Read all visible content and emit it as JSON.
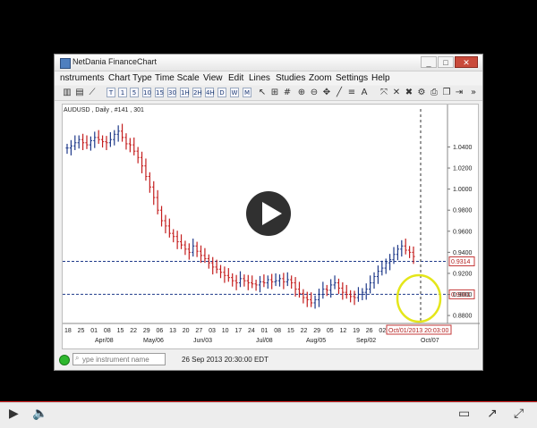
{
  "window": {
    "title": "NetDania FinanceChart",
    "min": "_",
    "max": "□",
    "close": "✕"
  },
  "menu": [
    "nstruments",
    "Chart Type",
    "Time Scale",
    "View",
    "Edit",
    "Lines",
    "Studies",
    "Zoom",
    "Settings",
    "Help"
  ],
  "toolbar": {
    "timescales": [
      "T",
      "1",
      "5",
      "10",
      "15",
      "30",
      "1H",
      "2H",
      "4H",
      "D",
      "W",
      "M"
    ],
    "icons": [
      "cursor-icon",
      "grid-icon",
      "hash-icon",
      "crosshair-icon",
      "close-x-icon",
      "print-icon",
      "scroll-icon",
      "more-icon"
    ]
  },
  "chart_data": {
    "type": "line",
    "title": "AUDUSD , Daily , #141 , 301",
    "ylim": [
      0.875,
      1.065
    ],
    "yticks": [
      "1.0400",
      "1.0200",
      "1.0000",
      "0.9800",
      "0.9600",
      "0.9400",
      "0.9200",
      "0.9000",
      "0.8800"
    ],
    "x_day_labels": [
      "18",
      "25",
      "01",
      "08",
      "15",
      "22",
      "29",
      "06",
      "13",
      "20",
      "27",
      "03",
      "10",
      "17",
      "24",
      "01",
      "08",
      "15",
      "22",
      "29",
      "05",
      "12",
      "19",
      "26",
      "02",
      "09",
      "16",
      "23"
    ],
    "x_month_labels": [
      "Apr/08",
      "May/06",
      "Jun/03",
      "Jul/08",
      "Aug/05",
      "Sep/02",
      "Oct/07"
    ],
    "series": [
      {
        "values": [
          1.039,
          1.041,
          1.044,
          1.047,
          1.044,
          1.042,
          1.046,
          1.049,
          1.047,
          1.045,
          1.044,
          1.047,
          1.052,
          1.055,
          1.049,
          1.043,
          1.042,
          1.036,
          1.03,
          1.022,
          1.012,
          1.002,
          0.992,
          0.98,
          0.97,
          0.965,
          0.958,
          0.955,
          0.95,
          0.947,
          0.943,
          0.94,
          0.946,
          0.941,
          0.937,
          0.934,
          0.93,
          0.926,
          0.924,
          0.921,
          0.918,
          0.916,
          0.913,
          0.911,
          0.915,
          0.913,
          0.911,
          0.91,
          0.909,
          0.912,
          0.911,
          0.914,
          0.912,
          0.913,
          0.915,
          0.912,
          0.914,
          0.911,
          0.905,
          0.901,
          0.897,
          0.895,
          0.892,
          0.895,
          0.9,
          0.905,
          0.904,
          0.909,
          0.911,
          0.906,
          0.902,
          0.9,
          0.898,
          0.897,
          0.9,
          0.902,
          0.905,
          0.911,
          0.917,
          0.922,
          0.925,
          0.93,
          0.933,
          0.938,
          0.943,
          0.946,
          0.942,
          0.94,
          0.936
        ]
      }
    ],
    "hlines": [
      {
        "value": 0.9314,
        "label": "0.9314"
      },
      {
        "value": 0.9001,
        "label": "0.9001"
      }
    ],
    "crosshair_date_label": "Oct/01/2013 20:03:00"
  },
  "status": {
    "input_placeholder": "ype instrument name",
    "time": "26 Sep 2013 20:30:00 EDT"
  }
}
